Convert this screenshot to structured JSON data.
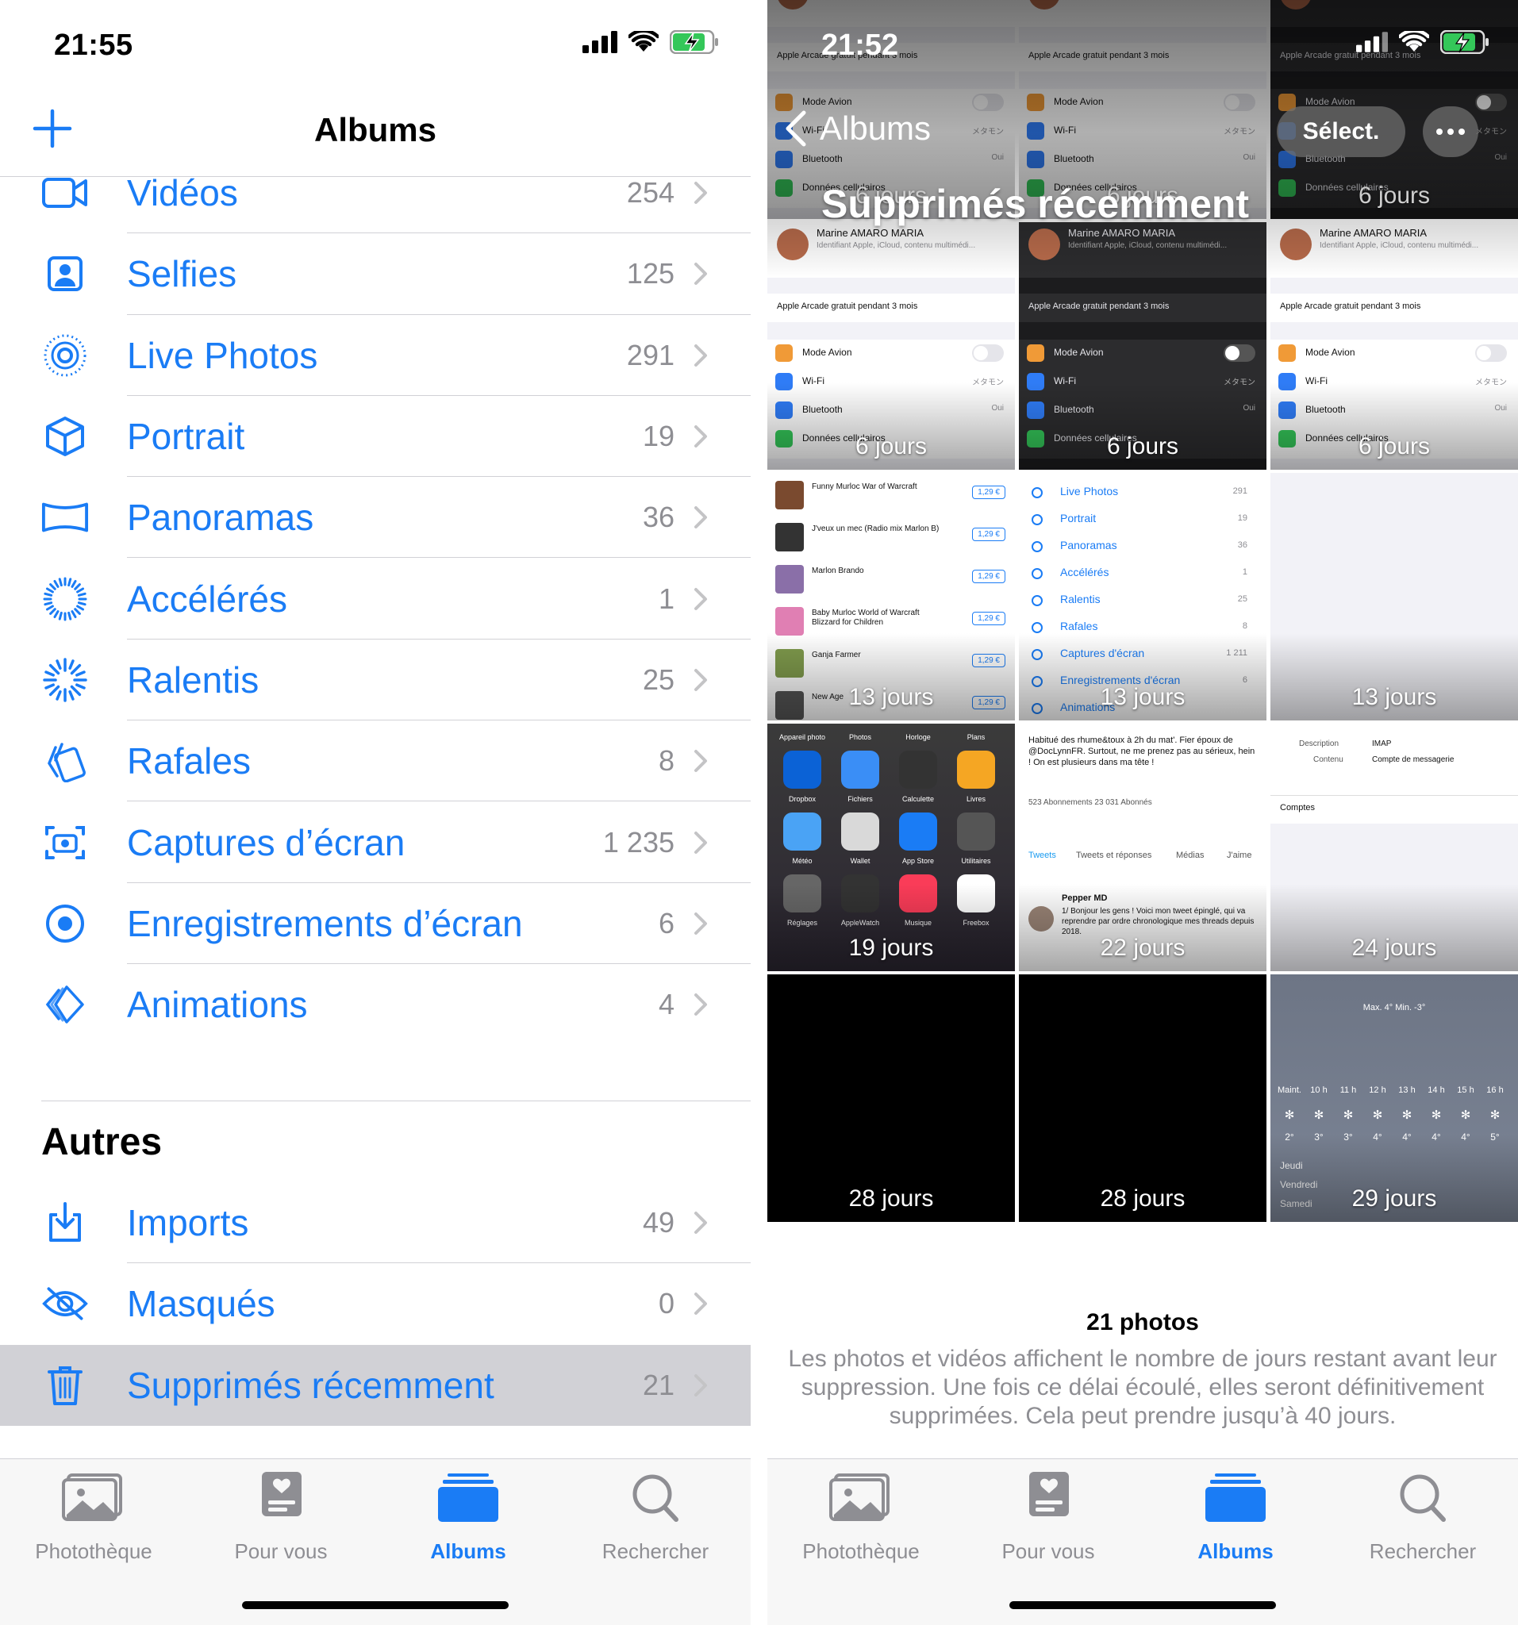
{
  "left": {
    "status_time": "21:55",
    "nav_title": "Albums",
    "media_types": [
      {
        "label": "Vidéos",
        "count": "254",
        "icon": "video-icon"
      },
      {
        "label": "Selfies",
        "count": "125",
        "icon": "selfie-icon"
      },
      {
        "label": "Live Photos",
        "count": "291",
        "icon": "live-photo-icon"
      },
      {
        "label": "Portrait",
        "count": "19",
        "icon": "cube-icon"
      },
      {
        "label": "Panoramas",
        "count": "36",
        "icon": "panorama-icon"
      },
      {
        "label": "Accélérés",
        "count": "1",
        "icon": "timelapse-icon"
      },
      {
        "label": "Ralentis",
        "count": "25",
        "icon": "slomo-icon"
      },
      {
        "label": "Rafales",
        "count": "8",
        "icon": "burst-icon"
      },
      {
        "label": "Captures d’écran",
        "count": "1 235",
        "icon": "screenshot-icon"
      },
      {
        "label": "Enregistrements d’écran",
        "count": "6",
        "icon": "screen-recording-icon"
      },
      {
        "label": "Animations",
        "count": "4",
        "icon": "animation-icon"
      }
    ],
    "others_title": "Autres",
    "others": [
      {
        "label": "Imports",
        "count": "49",
        "icon": "import-icon"
      },
      {
        "label": "Masqués",
        "count": "0",
        "icon": "hidden-eye-icon"
      },
      {
        "label": "Supprimés récemment",
        "count": "21",
        "icon": "trash-icon"
      }
    ]
  },
  "tabs": [
    {
      "label": "Photothèque",
      "icon": "photo-library-icon"
    },
    {
      "label": "Pour vous",
      "icon": "for-you-icon"
    },
    {
      "label": "Albums",
      "icon": "albums-icon"
    },
    {
      "label": "Rechercher",
      "icon": "search-icon"
    }
  ],
  "right": {
    "status_time": "21:52",
    "back_label": "Albums",
    "title": "Supprimés récemment",
    "select_label": "Sélect.",
    "cells": [
      {
        "days": "6 jours"
      },
      {
        "days": "6 jours"
      },
      {
        "days": "6 jours"
      },
      {
        "days": "6 jours"
      },
      {
        "days": "6 jours"
      },
      {
        "days": "6 jours"
      },
      {
        "days": "13 jours"
      },
      {
        "days": "13 jours"
      },
      {
        "days": "13 jours"
      },
      {
        "days": "19 jours"
      },
      {
        "days": "22 jours"
      },
      {
        "days": "24 jours"
      },
      {
        "days": "28 jours"
      },
      {
        "days": "28 jours"
      },
      {
        "days": "29 jours"
      }
    ],
    "thumb_text": {
      "arcade": "Apple Arcade gratuit pendant 3 mois",
      "avion": "Mode Avion",
      "wifi": "Wi-Fi",
      "bluetooth": "Bluetooth",
      "donnees": "Données cellulaires",
      "profile": "Marine AMARO MARIA",
      "profile_sub": "Identifiant Apple, iCloud, contenu multimédi...",
      "wifi_val": "メタモン",
      "bt_val": "Oui",
      "songs": [
        "Funny Murloc War of Warcraft",
        "J'veux un mec (Radio mix Marlon B)",
        "Marlon Brando",
        "Baby Murloc World of Warcraft Blizzard for Children",
        "Ganja Farmer",
        "New Age"
      ],
      "price": "1,29 €",
      "albums_list": [
        {
          "label": "Live Photos",
          "count": "291"
        },
        {
          "label": "Portrait",
          "count": "19"
        },
        {
          "label": "Panoramas",
          "count": "36"
        },
        {
          "label": "Accélérés",
          "count": "1"
        },
        {
          "label": "Ralentis",
          "count": "25"
        },
        {
          "label": "Rafales",
          "count": "8"
        },
        {
          "label": "Captures d'écran",
          "count": "1 211"
        },
        {
          "label": "Enregistrements d'écran",
          "count": "6"
        },
        {
          "label": "Animations",
          "count": ""
        }
      ],
      "apps_row1": [
        "Appareil photo",
        "Photos",
        "Horloge",
        "Plans"
      ],
      "apps_row2": [
        "Dropbox",
        "Fichiers",
        "Calculette",
        "Livres"
      ],
      "apps_row3": [
        "Météo",
        "Wallet",
        "App Store",
        "Utilitaires"
      ],
      "apps_row4": [
        "Réglages",
        "AppleWatch",
        "Musique",
        "Freebox"
      ],
      "tweet_bio": "Habitué des rhume&toux à 2h du mat'. Fier époux de @DocLynnFR. Surtout, ne me prenez pas au sérieux, hein ! On est plusieurs dans ma tête !",
      "tweet_stats": "523 Abonnements   23 031 Abonnés",
      "tweet_tabs": [
        "Tweets",
        "Tweets et réponses",
        "Médias",
        "J'aime"
      ],
      "tweet_author": "Pepper MD",
      "tweet_text": "1/ Bonjour les gens ! Voici mon tweet épinglé, qui va reprendre par ordre chronologique mes threads depuis 2018.",
      "mail_desc": "Description",
      "mail_desc_val": "IMAP",
      "mail_content": "Contenu",
      "mail_content_val": "Compte de messagerie",
      "mail_accounts": "Comptes",
      "weather_minmax": "Max. 4° Min. -3°",
      "weather_hours": [
        "Maint.",
        "10 h",
        "11 h",
        "12 h",
        "13 h",
        "14 h",
        "15 h",
        "16 h"
      ],
      "weather_temps": [
        "2°",
        "3°",
        "3°",
        "4°",
        "4°",
        "4°",
        "4°",
        "5°"
      ],
      "weather_days": [
        "Jeudi",
        "Vendredi",
        "Samedi"
      ]
    },
    "footer_count": "21 photos",
    "footer_text": "Les photos et vidéos affichent le nombre de jours restant avant leur suppression. Une fois ce délai écoulé, elles seront définitivement supprimées. Cela peut prendre jusqu’à 40 jours."
  },
  "colors": {
    "accent": "#1a7cf5",
    "gray": "#8e8e93",
    "separator": "#d1d1d6",
    "battery_green": "#34c759"
  }
}
